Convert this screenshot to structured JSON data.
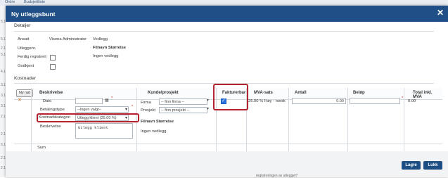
{
  "background": {
    "tabs": [
      "Ordre",
      "Budsjettliste"
    ],
    "left_edge": [
      "5.1",
      "5.1",
      "2.1",
      "5.1",
      "4.1",
      "3.1",
      "3.1",
      "3.1",
      "2.1",
      "2.1",
      "6.1",
      "2.1",
      "2.1"
    ],
    "bottom_text": "registreringen av utlegget?"
  },
  "dialog": {
    "title": "Ny utleggsbunt",
    "close_icon": "close-icon",
    "details": {
      "title": "Detaljer",
      "ansatt_label": "Ansatt",
      "ansatt_value": "Visena Administrator",
      "utleggsnr_label": "Utleggsnr.",
      "ferdig_label": "Ferdig registrert",
      "godkjent_label": "Godkjent",
      "vedlegg_label": "Vedlegg",
      "filename_header": "Filnavn Størrelse",
      "no_attachment": "Ingen vedlegg"
    },
    "costs": {
      "title": "Kostnader",
      "columns": [
        "Beskrivelse",
        "Kunde/prosjekt",
        "Fakturerbar",
        "MVA-sats",
        "Antall",
        "Beløp",
        "Total inkl. MVA"
      ],
      "new_row": "Ny rad",
      "dato_label": "Dato",
      "betalingstype_label": "Betalingstype",
      "betalingstype_value": "--Ingen valgt--",
      "kostnadskategori_label": "Kostnadskategori",
      "kostnadskategori_value": "Utlegg klient (25.00 %)",
      "beskrivelse_label": "Beskrivelse",
      "beskrivelse_value": "Utlegg klient",
      "firma_label": "Firma",
      "firma_placeholder": "-- finn firma --",
      "prosjekt_label": "Prosjekt",
      "prosjekt_placeholder": "-- finn prosjekt --",
      "filnavn_header": "Filnavn Størrelse",
      "ingen_vedlegg": "Ingen vedlegg",
      "mva_value": "25.00 % Høy - norsk",
      "antall_value": "0.00",
      "total_value": "0.00",
      "sum_label": "Sum",
      "required_mark": "*",
      "fakturerbar_checked": true,
      "delete_icon": "x-icon"
    },
    "footer": {
      "save": "Lagre",
      "close": "Lukk"
    }
  }
}
